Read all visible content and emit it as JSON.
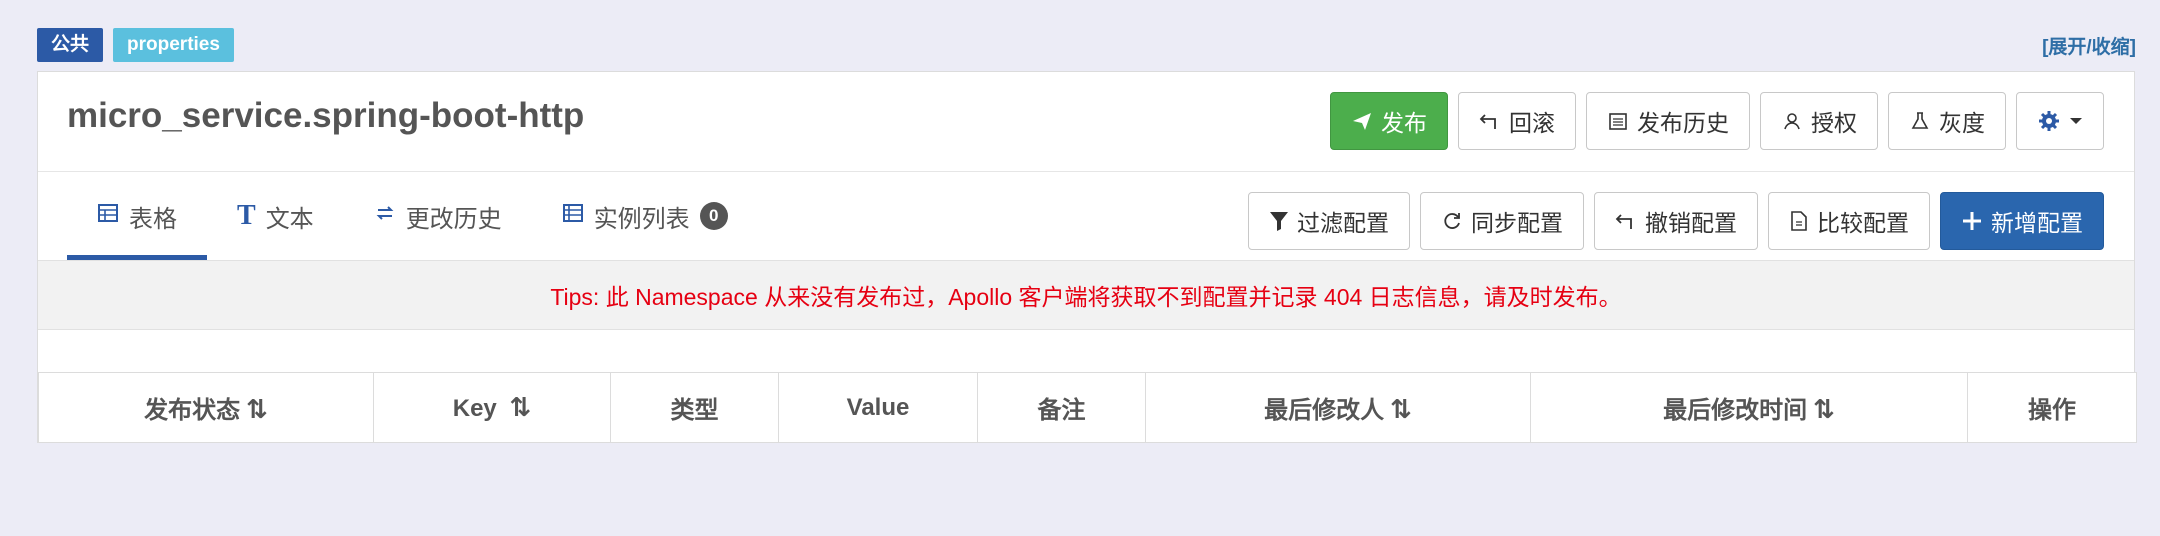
{
  "labels": {
    "env": "公共",
    "namespace": "properties"
  },
  "toggle_link": "[展开/收缩]",
  "namespace_title": "micro_service.spring-boot-http",
  "head_actions": {
    "publish": "发布",
    "rollback": "回滚",
    "publish_history": "发布历史",
    "authorize": "授权",
    "grayscale": "灰度"
  },
  "tabs": {
    "table": "表格",
    "text": "文本",
    "history": "更改历史",
    "instances": "实例列表",
    "instances_count": "0"
  },
  "tab_actions": {
    "filter": "过滤配置",
    "sync": "同步配置",
    "revoke": "撤销配置",
    "compare": "比较配置",
    "add": "新增配置"
  },
  "tips": "Tips: 此 Namespace 从来没有发布过，Apollo 客户端将获取不到配置并记录 404 日志信息，请及时发布。",
  "table_headers": {
    "status": "发布状态",
    "key": "Key",
    "type": "类型",
    "value": "Value",
    "comment": "备注",
    "modifier": "最后修改人",
    "modified_time": "最后修改时间",
    "operation": "操作"
  },
  "colors": {
    "accent": "#2c5aa6",
    "publish_green": "#4cae4c",
    "tip_red": "#e60012",
    "badge_light": "#5bc0de"
  }
}
